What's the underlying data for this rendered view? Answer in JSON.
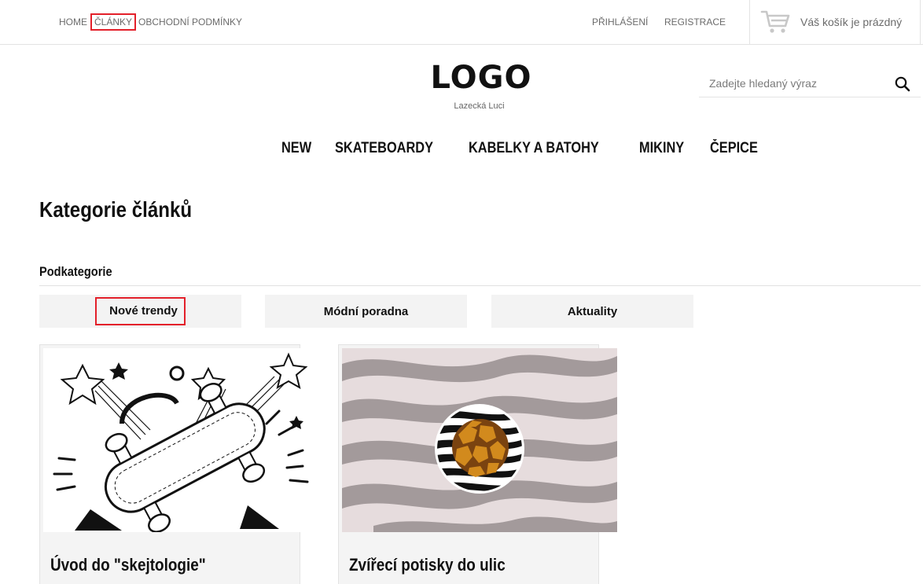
{
  "top_nav": {
    "links": [
      "HOME",
      "ČLÁNKY",
      "OBCHODNÍ PODMÍNKY"
    ],
    "login": "PŘIHLÁŠENÍ",
    "register": "REGISTRACE",
    "cart_text": "Váš košík je prázdný"
  },
  "header": {
    "logo": "LOGO",
    "logo_subtitle": "Lazecká Luci",
    "search_placeholder": "Zadejte hledaný výraz"
  },
  "main_nav": [
    "NEW",
    "SKATEBOARDY",
    "KABELKY A BATOHY",
    "MIKINY",
    "ČEPICE"
  ],
  "page": {
    "title": "Kategorie článků",
    "subcategories_heading": "Podkategorie",
    "subcategories": [
      "Nové trendy",
      "Módní poradna",
      "Aktuality"
    ]
  },
  "articles": [
    {
      "title": "Úvod do \"skejtologie\"",
      "image": "skateboard-sketch-image"
    },
    {
      "title": "Zvířecí potisky do ulic",
      "image": "zebra-giraffe-pattern-image"
    }
  ],
  "colors": {
    "highlight": "#e3202a",
    "muted_text": "#6b6b6b",
    "panel_bg": "#f3f3f3"
  }
}
